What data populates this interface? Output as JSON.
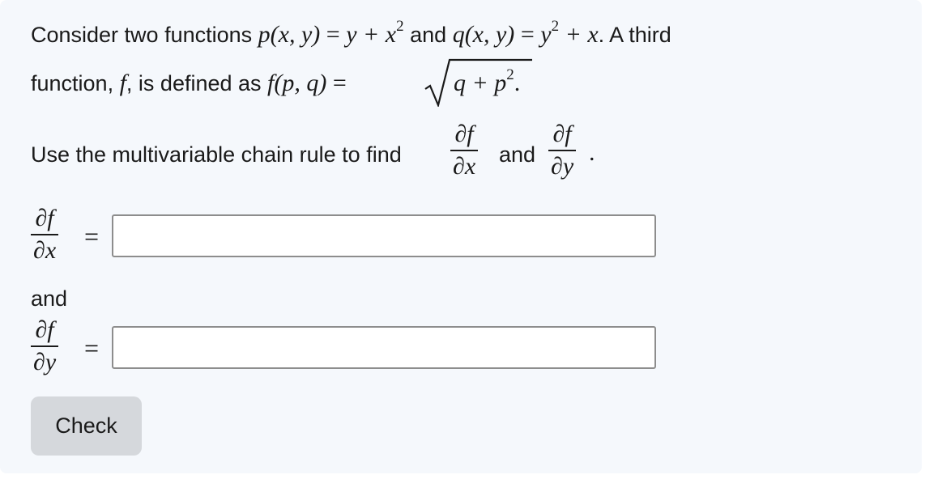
{
  "problem": {
    "line1_prefix": "Consider two functions ",
    "p_def_lhs": "p(x, y)",
    "eq": "=",
    "p_def_rhs_a": "y + x",
    "sup2": "2",
    "and": "and",
    "q_def_lhs": "q(x, y)",
    "q_def_rhs_a": "y",
    "q_def_rhs_b": "+ x",
    "line1_suffix": ". A third",
    "line2_prefix": "function, ",
    "f_symbol": "f",
    "line2_mid": ", is defined as ",
    "f_def_lhs": "f(p, q)",
    "sqrt_inner_a": "q + p",
    "period": ".",
    "instruction": "Use the multivariable chain rule to find",
    "partial_f": "∂f",
    "partial_x": "∂x",
    "partial_y": "∂y"
  },
  "answers": [
    {
      "numerator": "∂f",
      "denominator": "∂x",
      "equals": "=",
      "value": ""
    },
    {
      "numerator": "∂f",
      "denominator": "∂y",
      "equals": "=",
      "value": ""
    }
  ],
  "between_label": "and",
  "check_button": {
    "label": "Check"
  }
}
